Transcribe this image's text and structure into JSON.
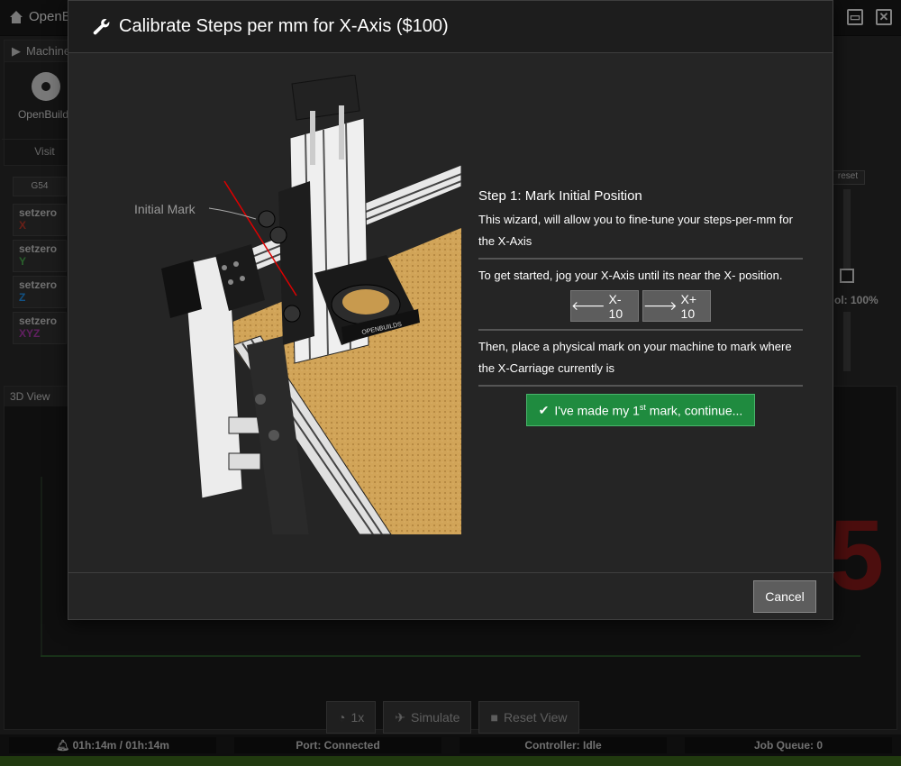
{
  "app": {
    "brand": "OpenB",
    "machine_tab": "Machine",
    "machine_name": "OpenBuilds",
    "visit_label": "Visit",
    "wcs": "G54",
    "setzero": [
      {
        "label": "setzero",
        "axis": "X",
        "color": "#c0392b"
      },
      {
        "label": "setzero",
        "axis": "Y",
        "color": "#4caf50"
      },
      {
        "label": "setzero",
        "axis": "Z",
        "color": "#2196f3"
      },
      {
        "label": "setzero",
        "axis": "XYZ",
        "color": "#b03ab0"
      }
    ],
    "reset_label": "reset",
    "override_pct": "ol: 100%",
    "view_tab": "3D View",
    "bottom_buttons": [
      "1x",
      "Simulate",
      "Reset View"
    ],
    "status": {
      "timer": "01h:14m / 01h:14m",
      "port": "Port: Connected",
      "controller": "Controller: Idle",
      "queue": "Job Queue: 0"
    }
  },
  "modal": {
    "title": "Calibrate Steps per mm for X-Axis ($100)",
    "illustration_label": "Initial Mark",
    "step_title": "Step 1: Mark Initial Position",
    "intro": "This wizard, will allow you to fine-tune your steps-per-mm for the X-Axis",
    "jog_instruction": "To get started, jog your X-Axis until its near the X- position.",
    "jog_minus": "X- 10",
    "jog_plus": "X+ 10",
    "mark_instruction": "Then, place a physical mark on your machine to mark where the X-Carriage currently is",
    "continue_pre": "I've made my 1",
    "continue_sup": "st",
    "continue_post": " mark, continue...",
    "cancel": "Cancel"
  },
  "colors": {
    "accent_green": "#1f8b3f",
    "modal_bg": "#252525",
    "button_grey": "#5d5d5d"
  },
  "icons": {
    "title_icon": "wrench-icon",
    "continue_icon": "check-icon",
    "jog_minus_icon": "arrow-left-icon",
    "jog_plus_icon": "arrow-right-icon"
  }
}
